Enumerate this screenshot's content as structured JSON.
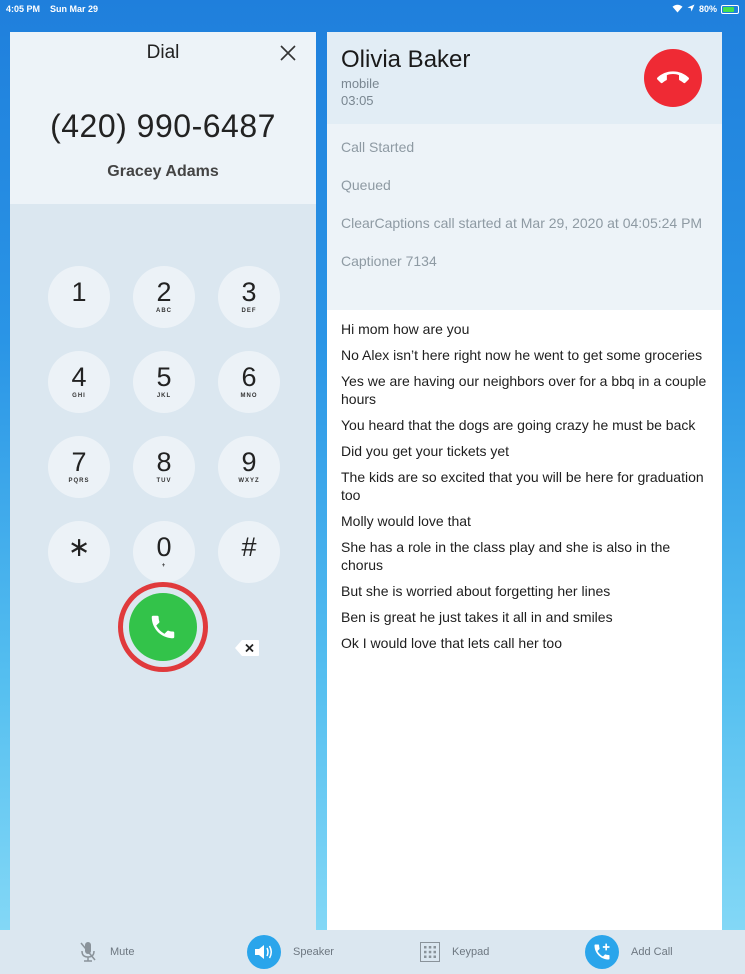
{
  "status_bar": {
    "time": "4:05 PM",
    "date": "Sun Mar 29",
    "battery": "80%",
    "battery_level": 0.8
  },
  "dial": {
    "title": "Dial",
    "number": "(420) 990-6487",
    "contact_name": "Gracey Adams",
    "keys": [
      {
        "digit": "1",
        "letters": ""
      },
      {
        "digit": "2",
        "letters": "ABC"
      },
      {
        "digit": "3",
        "letters": "DEF"
      },
      {
        "digit": "4",
        "letters": "GHI"
      },
      {
        "digit": "5",
        "letters": "JKL"
      },
      {
        "digit": "6",
        "letters": "MNO"
      },
      {
        "digit": "7",
        "letters": "PQRS"
      },
      {
        "digit": "8",
        "letters": "TUV"
      },
      {
        "digit": "9",
        "letters": "WXYZ"
      },
      {
        "digit": "∗",
        "letters": ""
      },
      {
        "digit": "0",
        "letters": "+"
      },
      {
        "digit": "#",
        "letters": ""
      }
    ]
  },
  "call": {
    "caller_name": "Olivia Baker",
    "line_type": "mobile",
    "duration": "03:05",
    "status_items": [
      "Call Started",
      "Queued",
      "ClearCaptions call started at Mar 29, 2020 at 04:05:24 PM",
      "Captioner 7134"
    ],
    "transcript": [
      "Hi mom how are you",
      "No Alex isn’t here right now he went to get some groceries",
      "Yes we are having our neighbors over for a bbq in a couple hours",
      "You heard that the dogs are going crazy he must be back",
      "Did you get your tickets yet",
      "The kids are so excited that you will be here for graduation too",
      "Molly would love that",
      "She has a role in the class play and she is also in the chorus",
      "But she is worried about forgetting her lines",
      "Ben is great he just takes it all in and smiles",
      "Ok I would love that lets call her too"
    ]
  },
  "toolbar": {
    "mute_label": "Mute",
    "speaker_label": "Speaker",
    "keypad_label": "Keypad",
    "add_call_label": "Add Call"
  },
  "colors": {
    "accent": "#2aa5eb",
    "call_green": "#33c34a",
    "hangup_red": "#ef2a34",
    "highlight_ring": "#e03a3c"
  }
}
